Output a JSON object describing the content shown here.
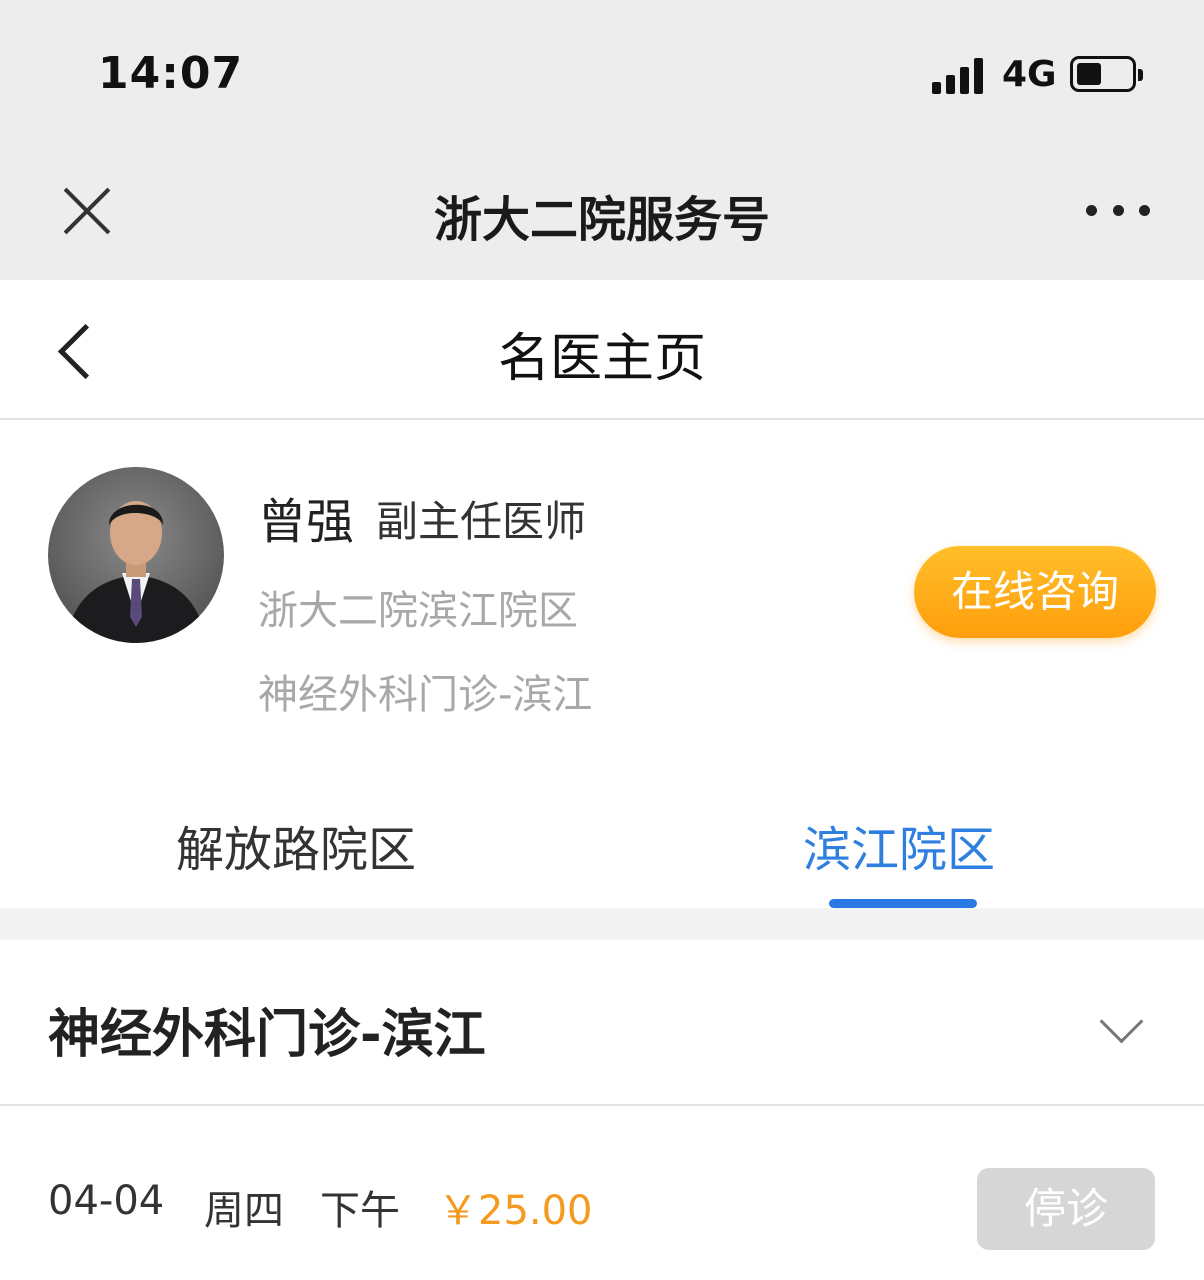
{
  "status_bar": {
    "time": "14:07",
    "network": "4G"
  },
  "wechat_bar": {
    "title": "浙大二院服务号"
  },
  "header": {
    "title": "名医主页"
  },
  "doctor": {
    "name": "曾强",
    "title": "副主任医师",
    "hospital": "浙大二院滨江院区",
    "department": "神经外科门诊-滨江",
    "consult_label": "在线咨询"
  },
  "tabs": [
    {
      "label": "解放路院区",
      "active": false
    },
    {
      "label": "滨江院区",
      "active": true
    }
  ],
  "department_select": {
    "label": "神经外科门诊-滨江"
  },
  "schedule": [
    {
      "date": "04-04",
      "weekday": "周四",
      "period": "下午",
      "price": "￥25.00",
      "status": "停诊"
    }
  ],
  "colors": {
    "accent_blue": "#2a78e4",
    "consult_orange": "#ffa812",
    "price_orange": "#f39a1f"
  }
}
